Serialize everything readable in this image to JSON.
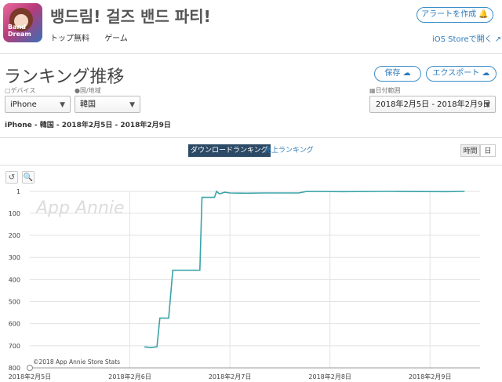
{
  "app": {
    "title": "뱅드림! 걸즈 밴드 파티!",
    "rank_type": "トップ無料",
    "category": "ゲーム",
    "icon": "bang-dream-app-icon",
    "icon_text": "Band Dream"
  },
  "header": {
    "alert_button": "アラートを作成 🔔",
    "ios_store_link": "iOS Storeで開く ↗"
  },
  "section": {
    "title": "ランキング推移",
    "save_button": "保存 ☁",
    "export_button": "エクスポート ☁"
  },
  "filters": {
    "device_label": "デバイス",
    "device_value": "iPhone",
    "country_label": "国/地域",
    "country_value": "韓国",
    "date_label": "日付範囲",
    "date_value": "2018年2月5日 - 2018年2月9日"
  },
  "summary": "iPhone - 韓国 - 2018年2月5日 - 2018年2月9日",
  "tabs": {
    "download": "ダウンロードランキング",
    "sales": "売上ランキング"
  },
  "granularity": {
    "hour": "時間",
    "day": "日"
  },
  "tools": {
    "reset": "↺",
    "zoom": "🔍"
  },
  "watermark": "App Annie",
  "credit": "©2018 App Annie Store Stats",
  "colors": {
    "line": "#3aa3a8",
    "accent": "#2c7bbd",
    "active_tab": "#2c4a66"
  },
  "chart_data": {
    "type": "line",
    "title": "",
    "xlabel": "",
    "ylabel": "",
    "y_reversed": true,
    "ylim": [
      800,
      1
    ],
    "y_ticks": [
      1,
      100,
      200,
      300,
      400,
      500,
      600,
      700,
      800
    ],
    "x_ticks": [
      "2018年2月5日",
      "2018年2月6日",
      "2018年2月7日",
      "2018年2月8日",
      "2018年2月9日"
    ],
    "xlim_hours": [
      0,
      108
    ],
    "grid": true,
    "series": [
      {
        "points": [
          {
            "hour": 27.5,
            "rank": 705
          },
          {
            "hour": 29.0,
            "rank": 708
          },
          {
            "hour": 30.5,
            "rank": 705
          },
          {
            "hour": 31.2,
            "rank": 575
          },
          {
            "hour": 33.3,
            "rank": 575
          },
          {
            "hour": 34.3,
            "rank": 358
          },
          {
            "hour": 40.8,
            "rank": 358
          },
          {
            "hour": 41.3,
            "rank": 28
          },
          {
            "hour": 44.3,
            "rank": 28
          },
          {
            "hour": 44.8,
            "rank": 1
          },
          {
            "hour": 45.5,
            "rank": 12
          },
          {
            "hour": 46.8,
            "rank": 5
          },
          {
            "hour": 48.0,
            "rank": 8
          },
          {
            "hour": 52.0,
            "rank": 9
          },
          {
            "hour": 56.0,
            "rank": 8
          },
          {
            "hour": 64.5,
            "rank": 8
          },
          {
            "hour": 66.5,
            "rank": 1
          },
          {
            "hour": 75.0,
            "rank": 2
          },
          {
            "hour": 86.0,
            "rank": 1
          },
          {
            "hour": 100.0,
            "rank": 2
          },
          {
            "hour": 104.3,
            "rank": 1
          }
        ]
      }
    ]
  }
}
